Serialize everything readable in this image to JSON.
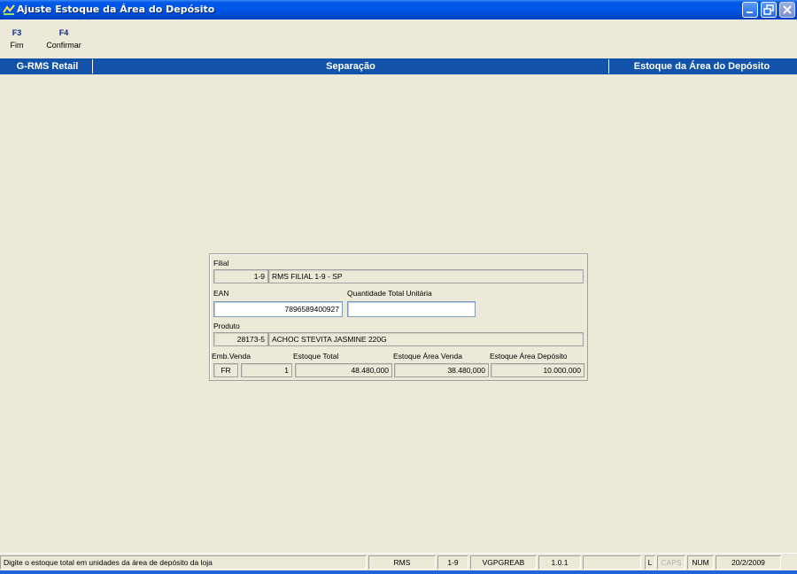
{
  "window": {
    "title": "Ajuste Estoque da Área do Depósito"
  },
  "toolbar": {
    "f3_key": "F3",
    "f3_label": "Fim",
    "f4_key": "F4",
    "f4_label": "Confirmar"
  },
  "header": {
    "left": "G-RMS Retail",
    "center": "Separação",
    "right": "Estoque da Área do Depósito"
  },
  "form": {
    "filial_label": "Filial",
    "filial_code": "1-9",
    "filial_name": "RMS FILIAL 1-9 - SP",
    "ean_label": "EAN",
    "ean_value": "7896589400927",
    "qtd_label": "Quantidade Total Unitária",
    "qtd_value": "",
    "produto_label": "Produto",
    "produto_code": "28173-5",
    "produto_name": "ACHOC STEVITA JASMINE 220G",
    "emb_label": "Emb.Venda",
    "emb_unit": "FR",
    "emb_qty": "1",
    "estoque_total_label": "Estoque Total",
    "estoque_total": "48.480,000",
    "estoque_venda_label": "Estoque Área Venda",
    "estoque_venda": "38.480,000",
    "estoque_deposito_label": "Estoque Área Depósito",
    "estoque_deposito": "10.000,000"
  },
  "statusbar": {
    "message": "Digite o estoque total em unidades da área de depósito da loja",
    "system": "RMS",
    "filial": "1-9",
    "program": "VGPGREAB",
    "version": "1.0.1",
    "extra": "",
    "l": "L",
    "caps": "CAPS",
    "num": "NUM",
    "date": "20/2/2009"
  },
  "colors": {
    "titlebar": "#0055e5",
    "header_band": "#1252a8",
    "background": "#ece9d8"
  }
}
